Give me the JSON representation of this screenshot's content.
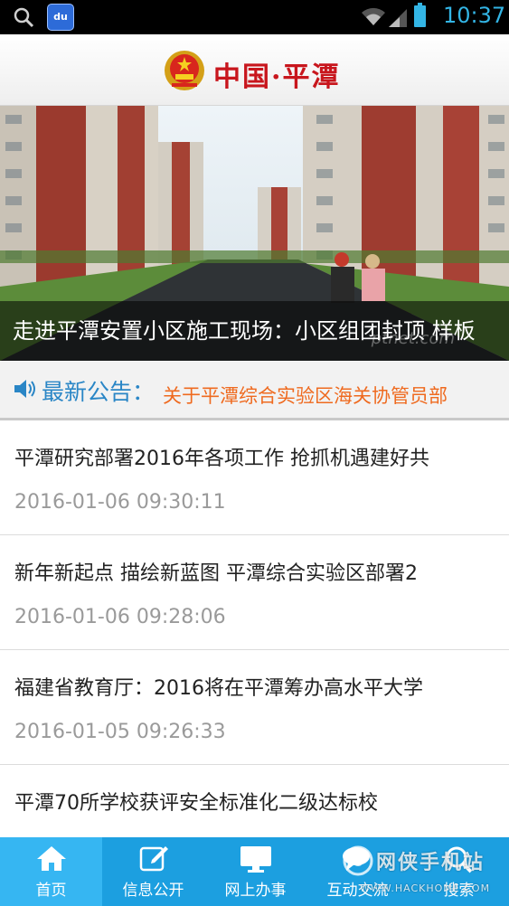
{
  "status_bar": {
    "time": "10:37",
    "app_icon_text": "du",
    "icons": [
      "search-icon",
      "app-icon",
      "wifi-icon",
      "signal-icon",
      "battery-icon"
    ]
  },
  "header": {
    "title": "中国·平潭",
    "emblem": "national-emblem-icon"
  },
  "banner": {
    "caption": "走进平潭安置小区施工现场：小区组团封顶 样板",
    "watermark": "ptnet.com"
  },
  "notice": {
    "label": "最新公告：",
    "text": "关于平潭综合实验区海关协管员部",
    "icon": "speaker-icon"
  },
  "news": [
    {
      "title": "平潭研究部署2016年各项工作 抢抓机遇建好共",
      "date": "2016-01-06 09:30:11"
    },
    {
      "title": "新年新起点 描绘新蓝图 平潭综合实验区部署2",
      "date": "2016-01-06 09:28:06"
    },
    {
      "title": "福建省教育厅：2016将在平潭筹办高水平大学",
      "date": "2016-01-05 09:26:33"
    },
    {
      "title": "平潭70所学校获评安全标准化二级达标校",
      "date": ""
    }
  ],
  "bottom_nav": [
    {
      "label": "首页",
      "icon": "home-icon",
      "active": true
    },
    {
      "label": "信息公开",
      "icon": "edit-icon",
      "active": false
    },
    {
      "label": "网上办事",
      "icon": "monitor-icon",
      "active": false
    },
    {
      "label": "互动交流",
      "icon": "chat-icon",
      "active": false
    },
    {
      "label": "搜索",
      "icon": "search-icon",
      "active": false
    }
  ],
  "watermark": {
    "main": "网侠手机站",
    "sub": "WWW.HACKHOME.COM"
  },
  "colors": {
    "accent": "#1c9fe0",
    "active_tab": "#36b6f2",
    "title_red": "#c8161d",
    "notice_blue": "#2a86c6",
    "notice_orange": "#ef6a1f",
    "date_gray": "#9a9a9a"
  }
}
